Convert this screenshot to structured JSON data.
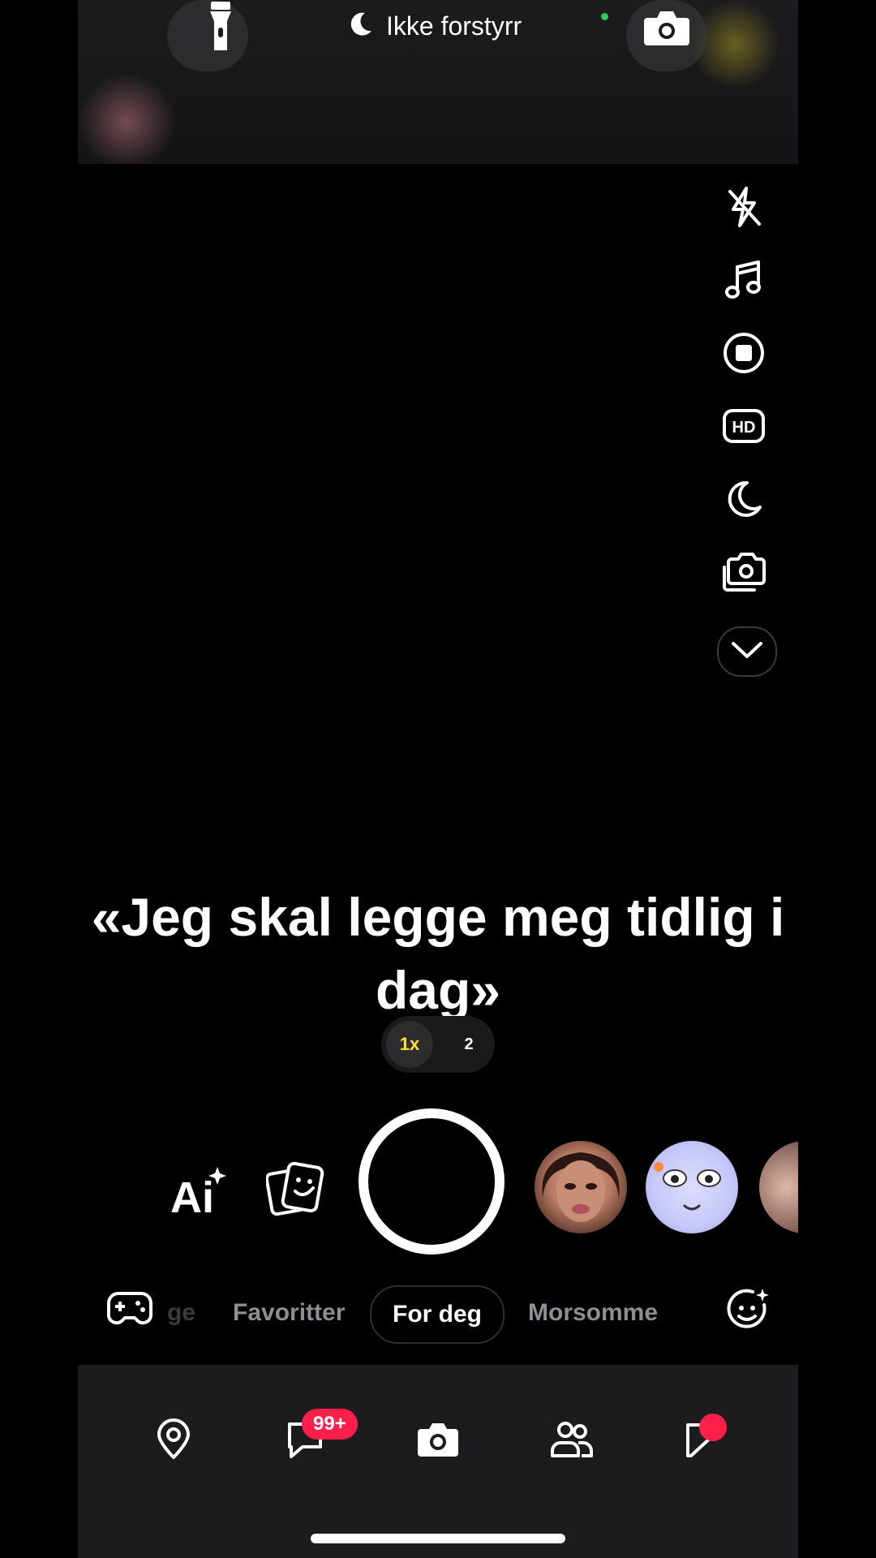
{
  "status_bar": {
    "focus_label": "Ikke forstyrr",
    "icons": [
      "flashlight-icon",
      "moon-icon",
      "camera-icon"
    ]
  },
  "camera_tools": {
    "icons": [
      "flash-off-icon",
      "music-note-icon",
      "stop-record-icon",
      "hd-icon",
      "night-mode-icon",
      "dual-camera-icon",
      "chevron-down-icon"
    ],
    "hd_label": "HD"
  },
  "caption": {
    "text": "«Jeg skal legge meg tidlig i dag»"
  },
  "zoom": {
    "options": [
      "1x",
      "2"
    ],
    "selected": "1x",
    "selected_color": "#ffe033"
  },
  "capture_row": {
    "ai_label": "Ai",
    "icons": [
      "ai-sparkle-icon",
      "memories-icon",
      "shutter-button",
      "lens-face-icon",
      "lens-cartoon-icon",
      "lens-face-icon"
    ]
  },
  "lens_tabs": {
    "items": [
      "ge",
      "Favoritter",
      "For deg",
      "Morsomme"
    ],
    "active": "For deg",
    "icons": [
      "game-controller-icon",
      "lens-explore-icon"
    ]
  },
  "bottom_nav": {
    "items": [
      "map-pin-icon",
      "chat-icon",
      "camera-icon",
      "friends-icon",
      "stories-icon"
    ],
    "chat_badge": "99+",
    "badge_color": "#ff1f4b"
  }
}
